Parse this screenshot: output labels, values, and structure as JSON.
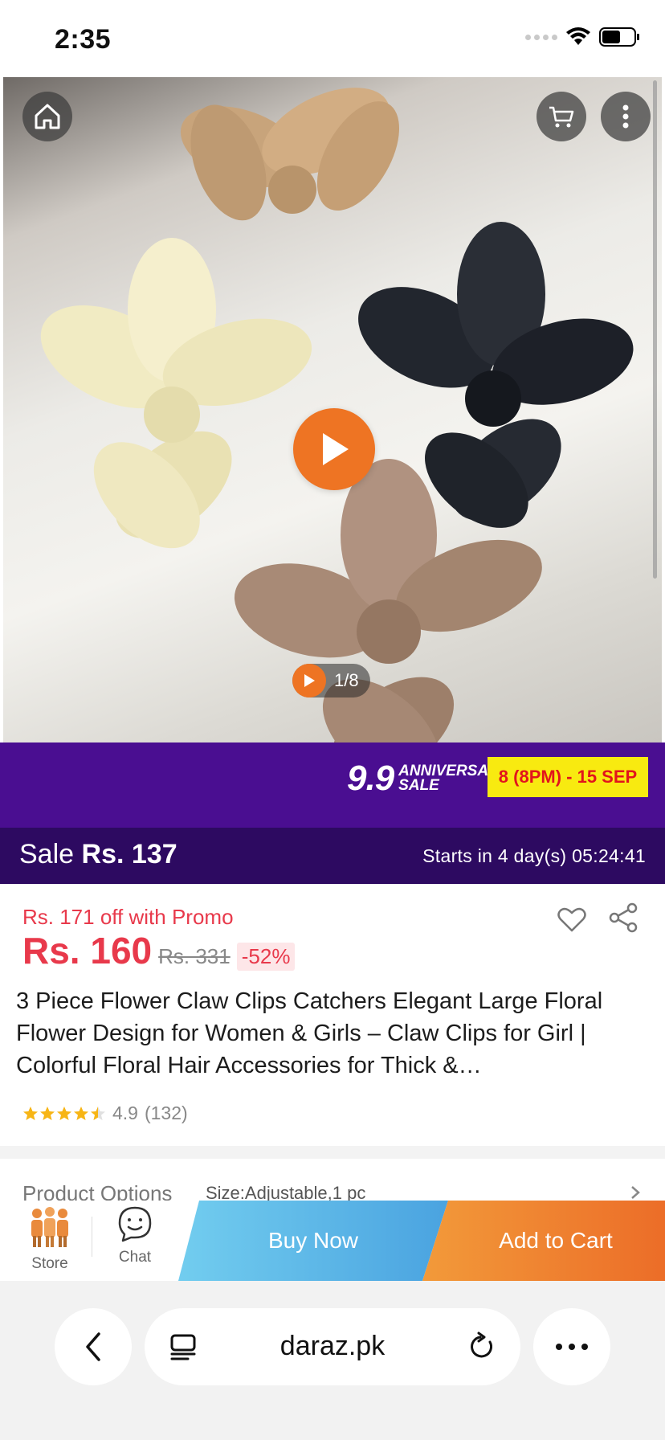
{
  "status_bar": {
    "time": "2:35"
  },
  "gallery": {
    "counter": "1/8"
  },
  "campaign": {
    "logo_big": "9.9",
    "logo_line1": "ANNIVERSARY",
    "logo_line2": "SALE",
    "date_range": "8 (8PM) - 15 SEP",
    "sale_prefix": "Sale",
    "sale_price": "Rs. 137",
    "countdown": "Starts in 4 day(s) 05:24:41"
  },
  "product": {
    "promo_off": "Rs. 171 off with Promo",
    "price": "Rs. 160",
    "original_price": "Rs. 331",
    "discount": "-52%",
    "title": "3 Piece Flower Claw Clips Catchers Elegant Large Floral Flower Design for Women & Girls – Claw Clips for Girl | Colorful Floral Hair Accessories for Thick &…",
    "rating": 4.9,
    "rating_text": "4.9",
    "review_count": "(132)"
  },
  "options": {
    "label": "Product Options",
    "value": "Size:Adjustable,1 pc"
  },
  "action_bar": {
    "store_label": "Store",
    "chat_label": "Chat",
    "buy_now": "Buy Now",
    "add_to_cart": "Add to Cart"
  },
  "browser": {
    "url": "daraz.pk"
  },
  "colors": {
    "accent_orange": "#ee7423",
    "price_red": "#e8394b",
    "promo_purple": "#4a0e91",
    "sale_purple": "#2d0a61",
    "buy_now_blue": "#4aa3e0",
    "promo_yellow": "#f8ea10"
  },
  "icons": [
    "home-icon",
    "cart-icon",
    "more-vertical-icon",
    "play-icon",
    "heart-icon",
    "share-icon",
    "star-icon",
    "store-icon",
    "chat-icon",
    "back-icon",
    "tabs-icon",
    "reload-icon",
    "more-horizontal-icon",
    "wifi-icon",
    "battery-icon"
  ]
}
